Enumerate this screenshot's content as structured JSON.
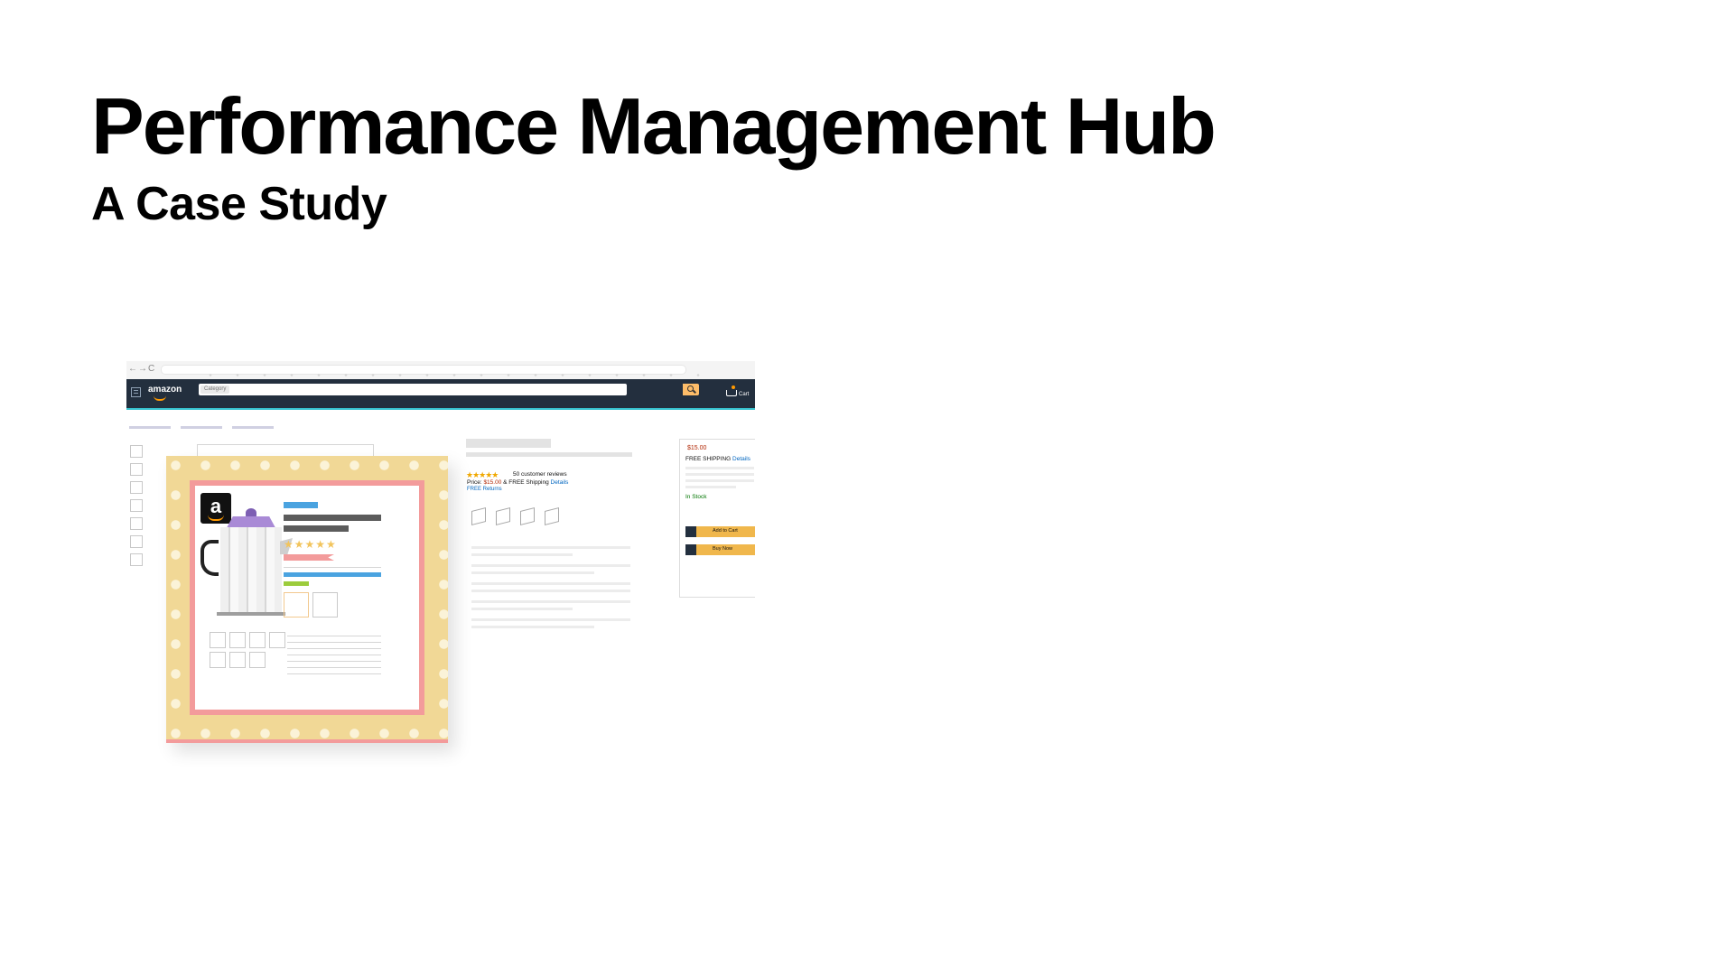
{
  "slide": {
    "title": "Performance Management Hub",
    "subtitle": "A Case Study"
  },
  "illustration": {
    "brand": "amazon",
    "search_category": "Category",
    "cart_label": "Cart",
    "rating_stars": "★★★★★",
    "reviews_text": "50 customer reviews",
    "price_label": "Price:",
    "price_value": "$15.00",
    "price_shipping": "& FREE Shipping",
    "details_link": "Details",
    "free_returns": "FREE Returns",
    "buybox": {
      "price": "$15.00",
      "shipping": "FREE SHIPPING",
      "details": "Details",
      "stock": "In Stock",
      "add_to_cart": "Add to Cart",
      "buy_now": "Buy Now"
    },
    "card_logo_letter": "a",
    "card_stars": "★★★★★",
    "colors": {
      "nav_bg": "#232f3e",
      "accent_orange": "#ff9900",
      "card_frame": "#f1d896",
      "card_border": "#f39b9b",
      "link_blue": "#0066c0",
      "price_red": "#b12704"
    }
  }
}
